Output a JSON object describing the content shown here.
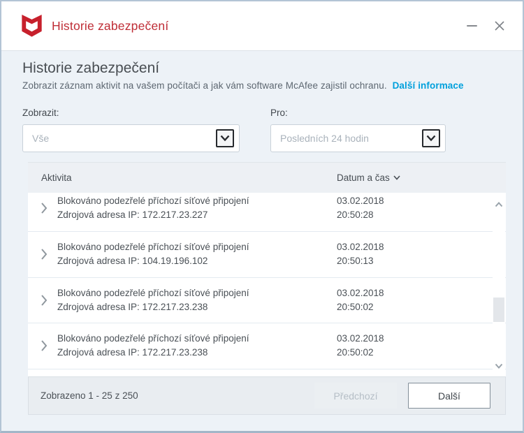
{
  "window": {
    "title": "Historie zabezpečení"
  },
  "icons": {
    "logo": "mcafee-shield",
    "minimize": "minimize-bar",
    "close": "close-x",
    "dropdown": "chevron-down",
    "sort": "chevron-down",
    "row_expander": "chevron-right",
    "scroll_up": "chevron-up",
    "scroll_down": "chevron-down"
  },
  "page": {
    "heading": "Historie zabezpečení",
    "subtitle": "Zobrazit záznam aktivit na vašem počítači a jak vám software McAfee zajistil ochranu.",
    "learn_more": "Další informace"
  },
  "filters": {
    "show_label": "Zobrazit:",
    "show_value": "Vše",
    "for_label": "Pro:",
    "for_value": "Posledních 24 hodin"
  },
  "table": {
    "columns": {
      "activity": "Aktivita",
      "datetime": "Datum a čas"
    },
    "rows": [
      {
        "activity": "Blokováno podezřelé příchozí síťové připojení",
        "detail": "Zdrojová adresa IP: 172.217.23.227",
        "date": "03.02.2018",
        "time": "20:50:28"
      },
      {
        "activity": "Blokováno podezřelé příchozí síťové připojení",
        "detail": "Zdrojová adresa IP: 104.19.196.102",
        "date": "03.02.2018",
        "time": "20:50:13"
      },
      {
        "activity": "Blokováno podezřelé příchozí síťové připojení",
        "detail": "Zdrojová adresa IP: 172.217.23.238",
        "date": "03.02.2018",
        "time": "20:50:02"
      },
      {
        "activity": "Blokováno podezřelé příchozí síťové připojení",
        "detail": "Zdrojová adresa IP: 172.217.23.238",
        "date": "03.02.2018",
        "time": "20:50:02"
      }
    ]
  },
  "footer": {
    "summary": "Zobrazeno 1 - 25 z 250",
    "prev_label": "Předchozí",
    "next_label": "Další"
  },
  "colors": {
    "accent_red": "#bf2d36",
    "logo_red": "#c7202c",
    "link_blue": "#00a0dc",
    "page_bg": "#edf2f7"
  }
}
